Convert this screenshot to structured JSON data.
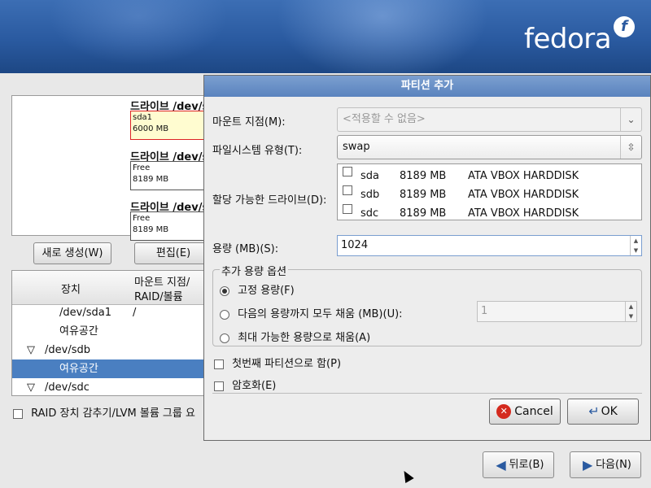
{
  "brand": {
    "logo_text": "fedora",
    "logo_mark": "f"
  },
  "graph": {
    "drives": [
      {
        "title": "드라이브 /dev/sda",
        "bar_name": "sda1",
        "bar_size": "6000 MB"
      },
      {
        "title": "드라이브 /dev/sdb",
        "bar_name": "Free",
        "bar_size": "8189 MB"
      },
      {
        "title": "드라이브 /dev/sdc",
        "bar_name": "Free",
        "bar_size": "8189 MB"
      }
    ]
  },
  "buttons": {
    "new": "새로 생성(W)",
    "edit": "편집(E)",
    "back": "뒤로(B)",
    "next": "다음(N)"
  },
  "tree": {
    "col_device": "장치",
    "col_mount_1": "마운트 지점/",
    "col_mount_2": "RAID/볼륨",
    "rows": [
      {
        "device": "/dev/sda1",
        "mount": "/"
      },
      {
        "device": "여유공간",
        "mount": ""
      },
      {
        "device": "/dev/sdb",
        "mount": ""
      },
      {
        "device": "여유공간",
        "mount": ""
      },
      {
        "device": "/dev/sdc",
        "mount": ""
      }
    ]
  },
  "raid_check_label": "RAID 장치 감추기/LVM 볼륨 그룹 요",
  "dialog": {
    "title": "파티션 추가",
    "mount_label": "마운트 지점(M):",
    "mount_value": "<적용할 수 없음>",
    "fs_label": "파일시스템 유형(T):",
    "fs_value": "swap",
    "drives_label": "할당 가능한 드라이브(D):",
    "drives": [
      {
        "name": "sda",
        "size": "8189 MB",
        "model": "ATA VBOX HARDDISK"
      },
      {
        "name": "sdb",
        "size": "8189 MB",
        "model": "ATA VBOX HARDDISK"
      },
      {
        "name": "sdc",
        "size": "8189 MB",
        "model": "ATA VBOX HARDDISK"
      }
    ],
    "size_label": "용량 (MB)(S):",
    "size_value": "1024",
    "options_label": "추가 용량 옵션",
    "opt_fixed": "고정 용량(F)",
    "opt_fill_to": "다음의 용량까지 모두 채움 (MB)(U):",
    "fill_to_value": "1",
    "opt_fill_max": "최대 가능한 용량으로 채움(A)",
    "primary_label": "첫번째 파티션으로 함(P)",
    "encrypt_label": "암호화(E)",
    "cancel_label": "Cancel",
    "ok_label": "OK"
  }
}
